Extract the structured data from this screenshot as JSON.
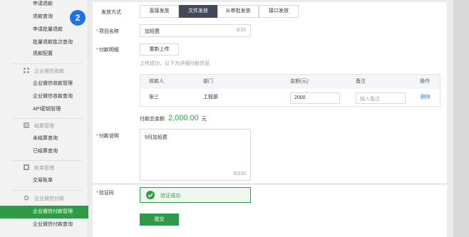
{
  "sidebar": {
    "items_top": [
      "申请退款",
      "退款查询",
      "申请批量退款",
      "批量退款批次查询",
      "退款配置"
    ],
    "section_collect": "企业微信收款",
    "items_collect": [
      "企业微信收款管理",
      "企业微信收款查询",
      "API密钥管理"
    ],
    "section_settle": "结算管理",
    "items_settle": [
      "未结算查询",
      "已结算查询"
    ],
    "section_bill": "账单管理",
    "items_bill": [
      "交易账单"
    ],
    "section_pay": "企业微信付款",
    "items_pay": [
      "企业微信付款管理",
      "企业微信付款查询"
    ],
    "step_badge": "2"
  },
  "form": {
    "method_label": "发放方式",
    "tabs": [
      "直接发放",
      "文件发放",
      "从审批发放",
      "接口发放"
    ],
    "active_tab": "文件发放",
    "project_label": "项目名称",
    "project_value": "加班费",
    "project_count": "3/10",
    "detail_label": "付款明细",
    "reupload_label": "重新上传",
    "upload_hint": "上传成功，以下为详细付款信息",
    "table": {
      "headers": [
        "收款人",
        "部门",
        "金额(元)",
        "备注",
        "操作"
      ],
      "row": {
        "payee": "张三",
        "dept": "工程部",
        "amount": "2000",
        "remark_placeholder": "输入备注",
        "action": "删除"
      }
    },
    "total_label": "付款总金额",
    "total_value": "2,000.00",
    "total_unit": "元",
    "desc_label": "付款说明",
    "desc_value": "9月加班费",
    "desc_count": "5/100",
    "captcha_label": "验证码",
    "captcha_status": "验证成功",
    "submit_label": "提交"
  },
  "colors": {
    "accent_green": "#2f9b48",
    "dark_tab": "#44495a",
    "badge_blue": "#1a73e8",
    "required_red": "#e54545"
  }
}
